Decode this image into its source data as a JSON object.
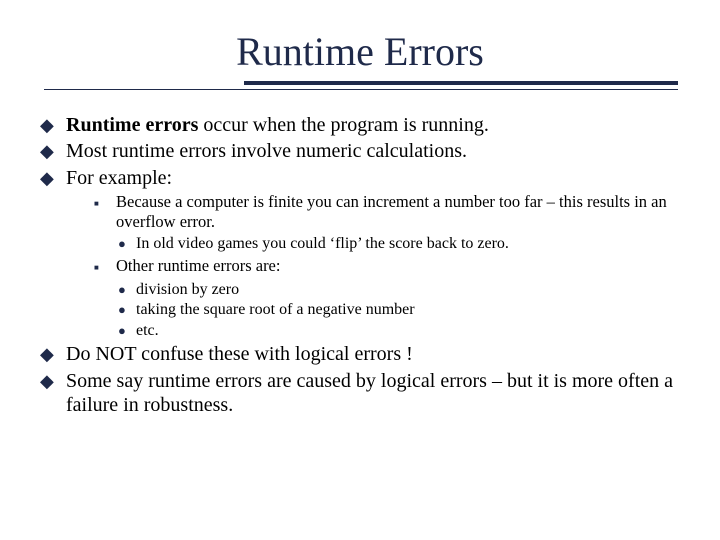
{
  "title": "Runtime Errors",
  "bullets1": {
    "b0_lead": "Runtime errors",
    "b0_rest": " occur when the program is running.",
    "b1": "Most runtime errors involve numeric calculations.",
    "b2": "For example:"
  },
  "bullets2": {
    "b0": "Because a computer is finite you can increment a number too far – this results in an overflow error.",
    "b1": "Other runtime errors are:"
  },
  "bullets3a": {
    "b0": "In old video games you could ‘flip’ the score back to zero."
  },
  "bullets3b": {
    "b0": "division by zero",
    "b1": "taking the square root of a negative number",
    "b2": "etc."
  },
  "bullets1b": {
    "b0": "Do NOT confuse these with logical errors !",
    "b1": "Some say runtime errors are caused by logical errors – but it is more often a failure in robustness."
  }
}
